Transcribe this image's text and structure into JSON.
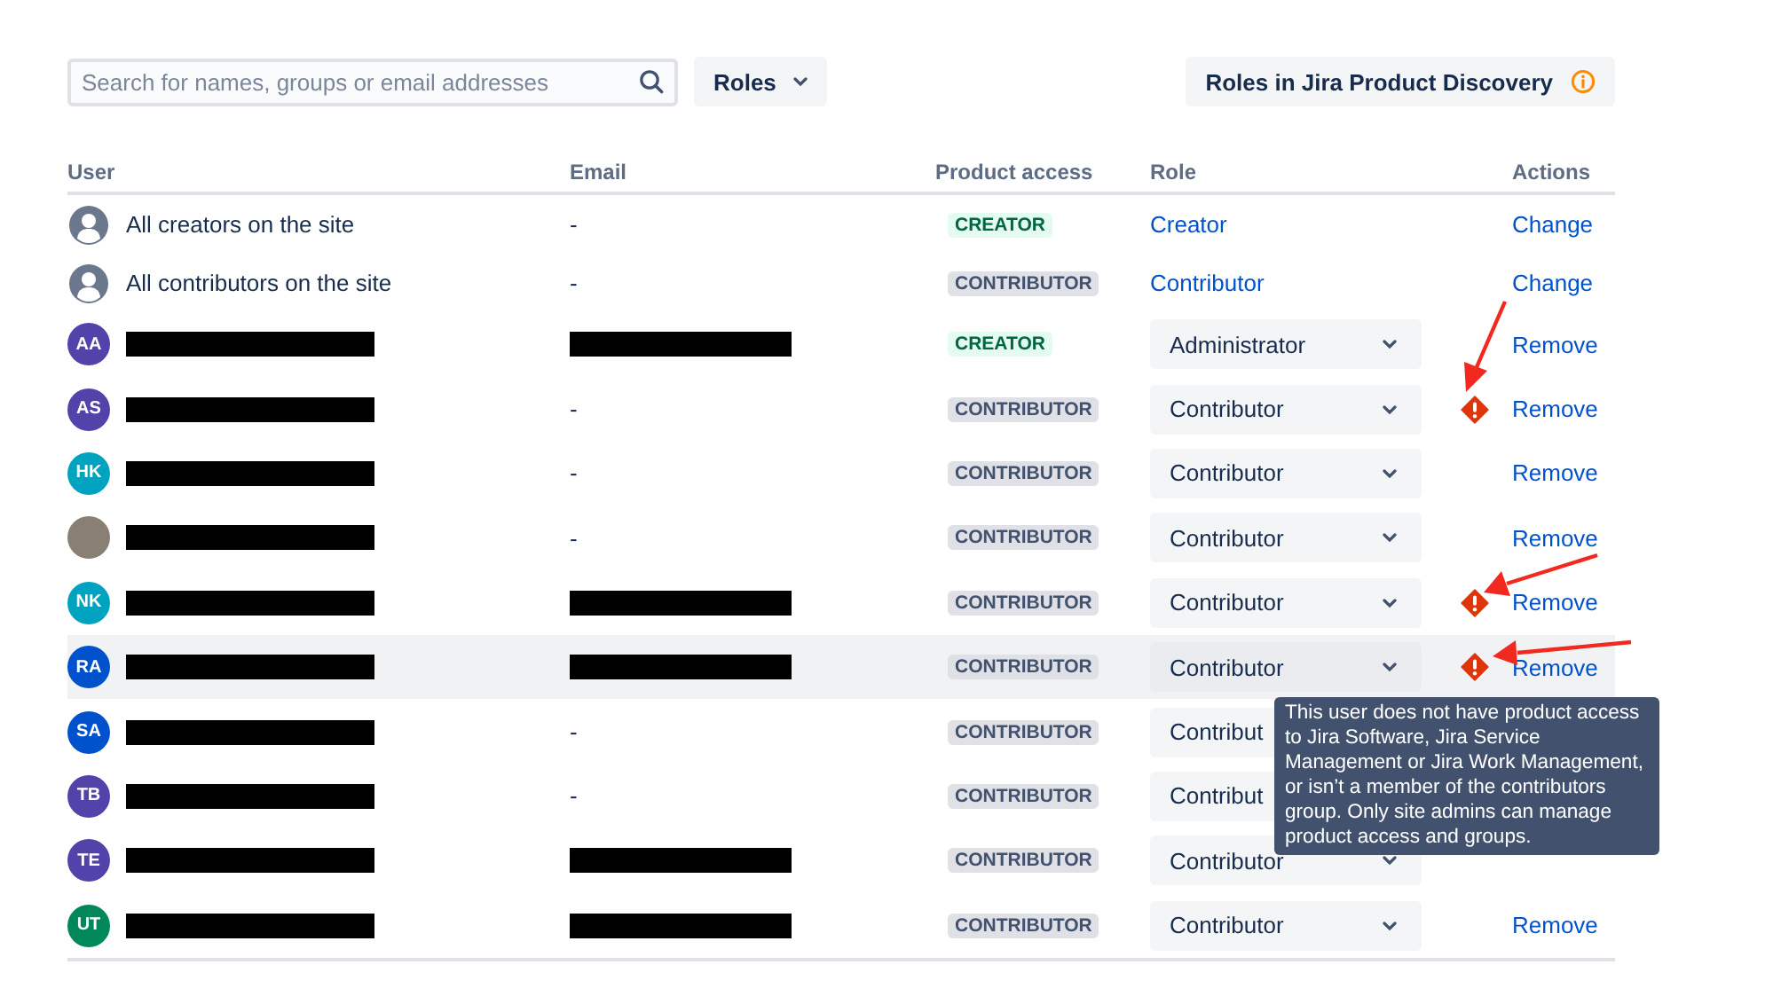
{
  "search": {
    "placeholder": "Search for names, groups or email addresses"
  },
  "roles_filter": {
    "label": "Roles"
  },
  "info_button": {
    "label": "Roles in Jira Product Discovery"
  },
  "table": {
    "columns": [
      "User",
      "Email",
      "Product access",
      "Role",
      "Actions"
    ],
    "rows": [
      {
        "kind": "group",
        "avatar": {
          "kind": "group"
        },
        "name": {
          "kind": "text",
          "text": "All creators on the site"
        },
        "email": {
          "kind": "text",
          "text": "-"
        },
        "access": {
          "kind": "creator",
          "label": "CREATOR"
        },
        "role": {
          "kind": "link",
          "label": "Creator"
        },
        "warning": false,
        "action": "Change",
        "highlighted": false
      },
      {
        "kind": "group",
        "avatar": {
          "kind": "group"
        },
        "name": {
          "kind": "text",
          "text": "All contributors on the site"
        },
        "email": {
          "kind": "text",
          "text": "-"
        },
        "access": {
          "kind": "contributor",
          "label": "CONTRIBUTOR"
        },
        "role": {
          "kind": "link",
          "label": "Contributor"
        },
        "warning": false,
        "action": "Change",
        "highlighted": false
      },
      {
        "kind": "user",
        "avatar": {
          "kind": "initials",
          "initials": "AA",
          "color": "#5243aa"
        },
        "name": {
          "kind": "redacted"
        },
        "email": {
          "kind": "redacted"
        },
        "access": {
          "kind": "creator",
          "label": "CREATOR"
        },
        "role": {
          "kind": "select",
          "label": "Administrator"
        },
        "warning": false,
        "action": "Remove",
        "highlighted": false
      },
      {
        "kind": "user",
        "avatar": {
          "kind": "initials",
          "initials": "AS",
          "color": "#5243aa"
        },
        "name": {
          "kind": "redacted"
        },
        "email": {
          "kind": "text",
          "text": "-"
        },
        "access": {
          "kind": "contributor",
          "label": "CONTRIBUTOR"
        },
        "role": {
          "kind": "select",
          "label": "Contributor"
        },
        "warning": true,
        "action": "Remove",
        "highlighted": false
      },
      {
        "kind": "user",
        "avatar": {
          "kind": "initials",
          "initials": "HK",
          "color": "#00a3bf"
        },
        "name": {
          "kind": "redacted"
        },
        "email": {
          "kind": "text",
          "text": "-"
        },
        "access": {
          "kind": "contributor",
          "label": "CONTRIBUTOR"
        },
        "role": {
          "kind": "select",
          "label": "Contributor"
        },
        "warning": false,
        "action": "Remove",
        "highlighted": false
      },
      {
        "kind": "user",
        "avatar": {
          "kind": "photo"
        },
        "name": {
          "kind": "redacted"
        },
        "email": {
          "kind": "text",
          "text": "-"
        },
        "access": {
          "kind": "contributor",
          "label": "CONTRIBUTOR"
        },
        "role": {
          "kind": "select",
          "label": "Contributor"
        },
        "warning": false,
        "action": "Remove",
        "highlighted": false
      },
      {
        "kind": "user",
        "avatar": {
          "kind": "initials",
          "initials": "NK",
          "color": "#00a3bf"
        },
        "name": {
          "kind": "redacted"
        },
        "email": {
          "kind": "redacted"
        },
        "access": {
          "kind": "contributor",
          "label": "CONTRIBUTOR"
        },
        "role": {
          "kind": "select",
          "label": "Contributor"
        },
        "warning": true,
        "action": "Remove",
        "highlighted": false
      },
      {
        "kind": "user",
        "avatar": {
          "kind": "initials",
          "initials": "RA",
          "color": "#0052cc"
        },
        "name": {
          "kind": "redacted"
        },
        "email": {
          "kind": "redacted"
        },
        "access": {
          "kind": "contributor",
          "label": "CONTRIBUTOR"
        },
        "role": {
          "kind": "select",
          "label": "Contributor"
        },
        "warning": true,
        "action": "Remove",
        "highlighted": true,
        "tooltip": "This user does not have product access to Jira Software, Jira Service Management or Jira Work Management, or isn’t a member of the contributors group. Only site admins can manage product access and groups."
      },
      {
        "kind": "user",
        "avatar": {
          "kind": "initials",
          "initials": "SA",
          "color": "#0052cc"
        },
        "name": {
          "kind": "redacted"
        },
        "email": {
          "kind": "text",
          "text": "-"
        },
        "access": {
          "kind": "contributor",
          "label": "CONTRIBUTOR"
        },
        "role": {
          "kind": "select",
          "label": "Contribut"
        },
        "warning": false,
        "highlighted": false
      },
      {
        "kind": "user",
        "avatar": {
          "kind": "initials",
          "initials": "TB",
          "color": "#5243aa"
        },
        "name": {
          "kind": "redacted"
        },
        "email": {
          "kind": "text",
          "text": "-"
        },
        "access": {
          "kind": "contributor",
          "label": "CONTRIBUTOR"
        },
        "role": {
          "kind": "select",
          "label": "Contribut"
        },
        "warning": false,
        "highlighted": false
      },
      {
        "kind": "user",
        "avatar": {
          "kind": "initials",
          "initials": "TE",
          "color": "#5243aa"
        },
        "name": {
          "kind": "redacted"
        },
        "email": {
          "kind": "redacted"
        },
        "access": {
          "kind": "contributor",
          "label": "CONTRIBUTOR"
        },
        "role": {
          "kind": "select",
          "label": "Contributor"
        },
        "warning": false,
        "highlighted": false
      },
      {
        "kind": "user",
        "avatar": {
          "kind": "initials",
          "initials": "UT",
          "color": "#00875a"
        },
        "name": {
          "kind": "redacted"
        },
        "email": {
          "kind": "redacted"
        },
        "access": {
          "kind": "contributor",
          "label": "CONTRIBUTOR"
        },
        "role": {
          "kind": "select",
          "label": "Contributor"
        },
        "warning": false,
        "action": "Remove",
        "highlighted": false
      }
    ]
  }
}
